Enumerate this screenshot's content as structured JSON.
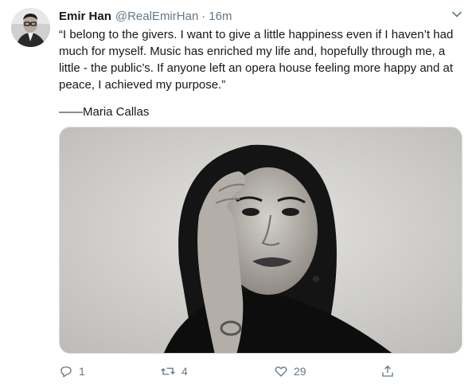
{
  "tweet": {
    "author": {
      "display_name": "Emir Han",
      "handle": "@RealEmirHan",
      "avatar_icon": "profile-photo"
    },
    "separator": "·",
    "timestamp": "16m",
    "menu_icon": "chevron-down-icon",
    "text": "“I belong to the givers. I want to give a little happiness even if I haven’t had much for myself. Music has enriched my life and, hopefully through me, a little - the public’s. If anyone left an opera house feeling more happy and at peace, I achieved my purpose.”",
    "signature": "——Maria Callas",
    "media": {
      "type": "photo",
      "tone": "black-and-white portrait"
    },
    "actions": {
      "reply_count": "1",
      "retweet_count": "4",
      "like_count": "29"
    }
  },
  "colors": {
    "text_primary": "#14171a",
    "text_secondary": "#657786",
    "border": "#d8dde2"
  }
}
